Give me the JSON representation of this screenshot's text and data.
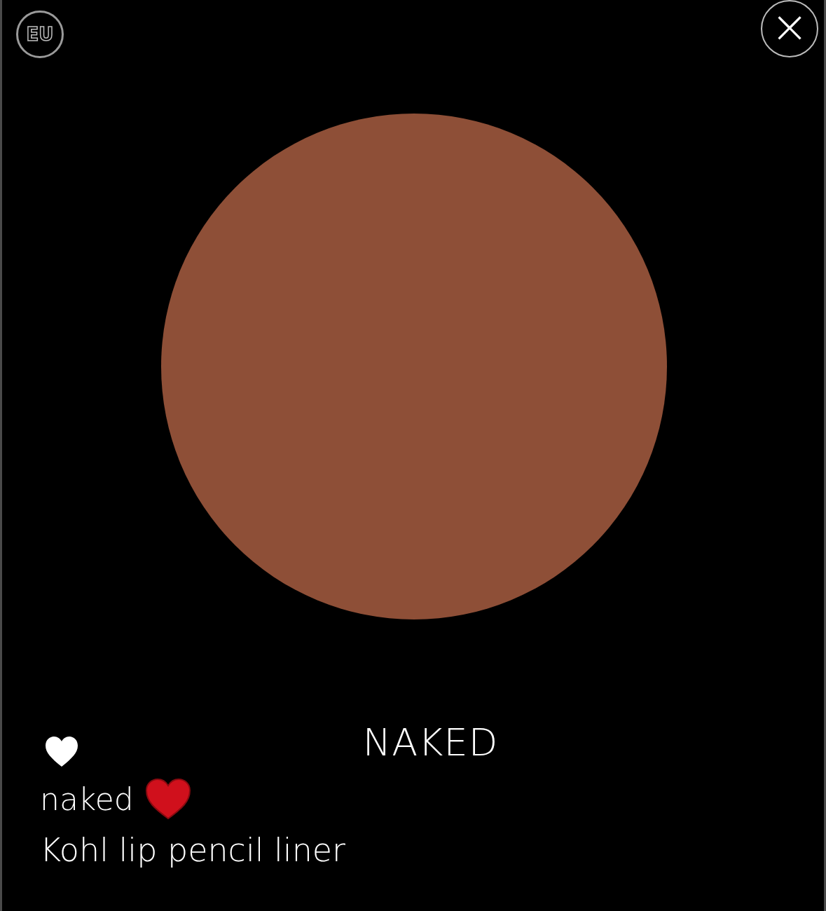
{
  "region_badge": "EU",
  "close_button": "×",
  "swatch": {
    "color": "#8e4f37"
  },
  "favorite": {
    "selected": false
  },
  "shade_title": "NAKED",
  "shade_name": "naked",
  "shade_loved": true,
  "product": "Kohl lip pencil liner"
}
